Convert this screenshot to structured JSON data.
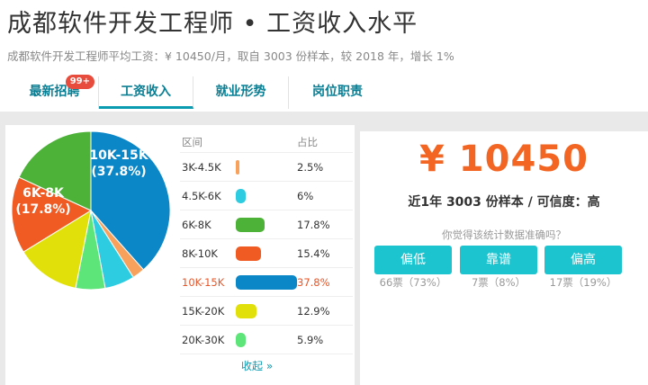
{
  "header": {
    "title": "成都软件开发工程师 • 工资收入水平",
    "subtitle": "成都软件开发工程师平均工资：¥ 10450/月，取自 3003 份样本，较 2018 年，增长 1%"
  },
  "tabs": [
    {
      "label": "最新招聘",
      "badge": "99+"
    },
    {
      "label": "工资收入",
      "active": true
    },
    {
      "label": "就业形势"
    },
    {
      "label": "岗位职责"
    }
  ],
  "chart_data": {
    "type": "pie",
    "header": {
      "range": "区间",
      "percent": "占比"
    },
    "slices": [
      {
        "label": "3K-4.5K",
        "value": 2.5,
        "pct_text": "2.5%",
        "color": "#f7a15d"
      },
      {
        "label": "4.5K-6K",
        "value": 6,
        "pct_text": "6%",
        "color": "#2ecce0"
      },
      {
        "label": "6K-8K",
        "value": 17.8,
        "pct_text": "17.8%",
        "color": "#4db338"
      },
      {
        "label": "8K-10K",
        "value": 15.4,
        "pct_text": "15.4%",
        "color": "#ef5b23"
      },
      {
        "label": "10K-15K",
        "value": 37.8,
        "pct_text": "37.8%",
        "color": "#0b86c7",
        "highlight": true
      },
      {
        "label": "15K-20K",
        "value": 12.9,
        "pct_text": "12.9%",
        "color": "#e1e00b"
      },
      {
        "label": "20K-30K",
        "value": 5.9,
        "pct_text": "5.9%",
        "color": "#5ee579"
      }
    ],
    "pie_labels": [
      {
        "line1": "10K-15K",
        "line2": "(37.8%)"
      },
      {
        "line1": "6K-8K",
        "line2": "(17.8%)"
      }
    ],
    "bar_max": 37.8
  },
  "collapse_label": "收起 »",
  "summary": {
    "salary": "¥ 10450",
    "sample_text": "近1年 3003 份样本 / 可信度：高",
    "question": "你觉得该统计数据准确吗？",
    "votes": [
      {
        "label": "偏低",
        "count": "66票（73%）"
      },
      {
        "label": "靠谱",
        "count": "7票（8%）"
      },
      {
        "label": "偏高",
        "count": "17票（19%）"
      }
    ]
  }
}
